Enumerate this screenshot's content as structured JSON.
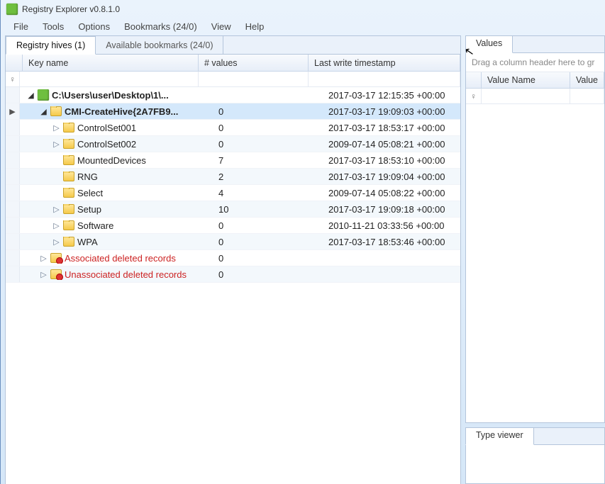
{
  "app": {
    "title": "Registry Explorer v0.8.1.0"
  },
  "menu": {
    "file": "File",
    "tools": "Tools",
    "options": "Options",
    "bookmarks": "Bookmarks (24/0)",
    "view": "View",
    "help": "Help"
  },
  "tabs": {
    "hives": "Registry hives (1)",
    "bookmarks": "Available bookmarks (24/0)"
  },
  "columns": {
    "key": "Key name",
    "values": "# values",
    "timestamp": "Last write timestamp"
  },
  "tree": {
    "rows": [
      {
        "indent": 0,
        "toggle": "▢",
        "icon": "cube",
        "bold": true,
        "label": "C:\\Users\\user\\Desktop\\1\\...",
        "values": "",
        "ts": "2017-03-17 12:15:35 +00:00",
        "gutter": "",
        "alt": false,
        "red": false,
        "selected": false
      },
      {
        "indent": 1,
        "toggle": "▢",
        "icon": "folder-open",
        "bold": true,
        "label": "CMI-CreateHive{2A7FB9...",
        "values": "0",
        "ts": "2017-03-17 19:09:03 +00:00",
        "gutter": "▶",
        "alt": true,
        "red": false,
        "selected": true
      },
      {
        "indent": 2,
        "toggle": "▷",
        "icon": "folder",
        "bold": false,
        "label": "ControlSet001",
        "values": "0",
        "ts": "2017-03-17 18:53:17 +00:00",
        "gutter": "",
        "alt": false,
        "red": false,
        "selected": false
      },
      {
        "indent": 2,
        "toggle": "▷",
        "icon": "folder",
        "bold": false,
        "label": "ControlSet002",
        "values": "0",
        "ts": "2009-07-14 05:08:21 +00:00",
        "gutter": "",
        "alt": true,
        "red": false,
        "selected": false
      },
      {
        "indent": 2,
        "toggle": "",
        "icon": "folder",
        "bold": false,
        "label": "MountedDevices",
        "values": "7",
        "ts": "2017-03-17 18:53:10 +00:00",
        "gutter": "",
        "alt": false,
        "red": false,
        "selected": false
      },
      {
        "indent": 2,
        "toggle": "",
        "icon": "folder",
        "bold": false,
        "label": "RNG",
        "values": "2",
        "ts": "2017-03-17 19:09:04 +00:00",
        "gutter": "",
        "alt": true,
        "red": false,
        "selected": false
      },
      {
        "indent": 2,
        "toggle": "",
        "icon": "folder",
        "bold": false,
        "label": "Select",
        "values": "4",
        "ts": "2009-07-14 05:08:22 +00:00",
        "gutter": "",
        "alt": false,
        "red": false,
        "selected": false
      },
      {
        "indent": 2,
        "toggle": "▷",
        "icon": "folder",
        "bold": false,
        "label": "Setup",
        "values": "10",
        "ts": "2017-03-17 19:09:18 +00:00",
        "gutter": "",
        "alt": true,
        "red": false,
        "selected": false
      },
      {
        "indent": 2,
        "toggle": "▷",
        "icon": "folder",
        "bold": false,
        "label": "Software",
        "values": "0",
        "ts": "2010-11-21 03:33:56 +00:00",
        "gutter": "",
        "alt": false,
        "red": false,
        "selected": false
      },
      {
        "indent": 2,
        "toggle": "▷",
        "icon": "folder",
        "bold": false,
        "label": "WPA",
        "values": "0",
        "ts": "2017-03-17 18:53:46 +00:00",
        "gutter": "",
        "alt": true,
        "red": false,
        "selected": false
      },
      {
        "indent": 1,
        "toggle": "▷",
        "icon": "folder-red",
        "bold": false,
        "label": "Associated deleted records",
        "values": "0",
        "ts": "",
        "gutter": "",
        "alt": false,
        "red": true,
        "selected": false
      },
      {
        "indent": 1,
        "toggle": "▷",
        "icon": "folder-red",
        "bold": false,
        "label": "Unassociated deleted records",
        "values": "0",
        "ts": "",
        "gutter": "",
        "alt": true,
        "red": true,
        "selected": false
      }
    ]
  },
  "right": {
    "values_tab": "Values",
    "group_hint": "Drag a column header here to gr",
    "col_name": "Value Name",
    "col_value": "Value",
    "type_viewer": "Type viewer"
  },
  "glyphs": {
    "filter": "♀",
    "pointer": "▶"
  }
}
